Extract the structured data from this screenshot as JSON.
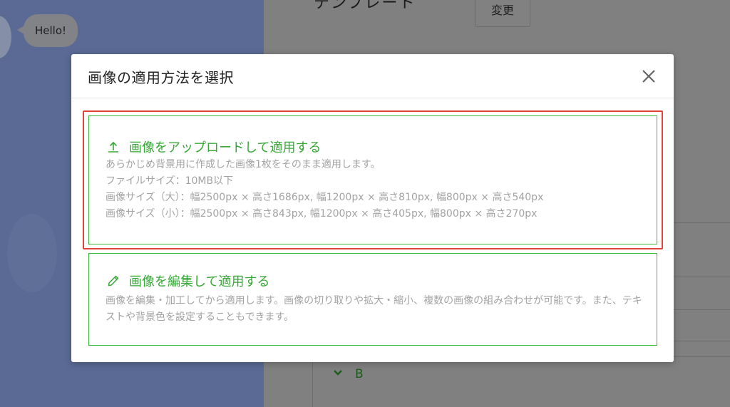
{
  "background": {
    "chat_bubble_text": "Hello!",
    "template_heading": "テンプレート",
    "change_button": "変更",
    "section_label": "B"
  },
  "modal": {
    "title": "画像の適用方法を選択",
    "close_icon": "close-icon",
    "options": [
      {
        "icon": "upload-icon",
        "title": "画像をアップロードして適用する",
        "lines": [
          "あらかじめ背景用に作成した画像1枚をそのまま適用します。",
          "ファイルサイズ：10MB以下",
          "画像サイズ（大）：幅2500px × 高さ1686px, 幅1200px × 高さ810px, 幅800px × 高さ540px",
          "画像サイズ（小）：幅2500px × 高さ843px, 幅1200px × 高さ405px, 幅800px × 高さ270px"
        ],
        "highlighted": true
      },
      {
        "icon": "pencil-icon",
        "title": "画像を編集して適用する",
        "lines": [
          "画像を編集・加工してから適用します。画像の切り取りや拡大・縮小、複数の画像の組み合わせが可能です。また、テキストや背景色を設定することもできます。"
        ],
        "highlighted": false
      }
    ]
  },
  "colors": {
    "accent_green": "#37a837",
    "highlight_red": "#e0433a",
    "description_gray": "#a3a3a3"
  }
}
